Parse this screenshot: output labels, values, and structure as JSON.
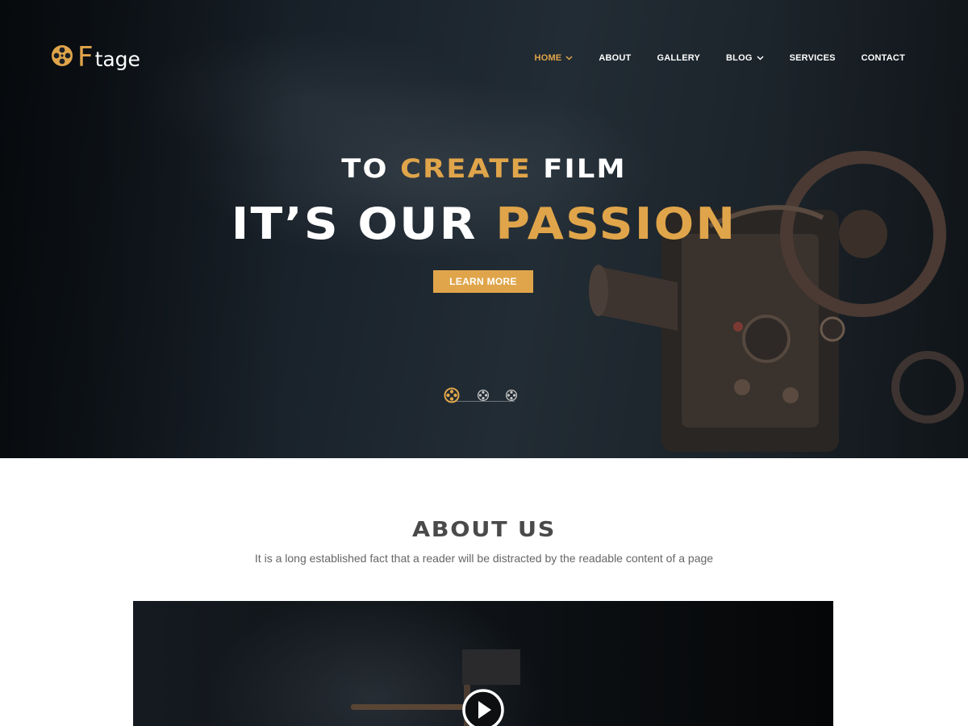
{
  "brand": {
    "logo_first": "F",
    "logo_rest": "tage",
    "accent_color": "#e0a54a"
  },
  "nav": {
    "items": [
      {
        "label": "HOME",
        "has_dropdown": true,
        "active": true
      },
      {
        "label": "ABOUT",
        "has_dropdown": false
      },
      {
        "label": "GALLERY",
        "has_dropdown": false
      },
      {
        "label": "BLOG",
        "has_dropdown": true
      },
      {
        "label": "SERVICES",
        "has_dropdown": false
      },
      {
        "label": "CONTACT",
        "has_dropdown": false
      }
    ]
  },
  "hero": {
    "subtitle_part1": "TO ",
    "subtitle_accent": "CREATE",
    "subtitle_part2": " FILM",
    "title_part1": "IT’S OUR ",
    "title_accent": "PASSION",
    "button_label": "LEARN MORE",
    "slides": {
      "count": 3,
      "active_index": 0
    }
  },
  "about": {
    "title": "ABOUT US",
    "description": "It is a long established fact that a reader will be distracted by the readable content of a page",
    "video_icon": "play-icon"
  }
}
